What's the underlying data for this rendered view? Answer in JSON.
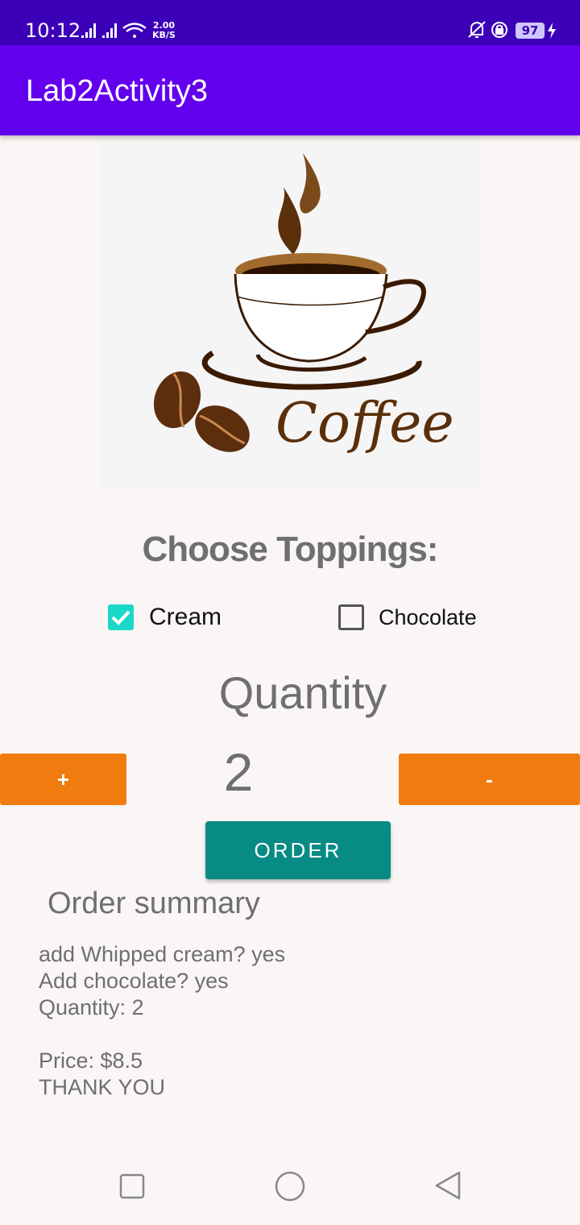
{
  "status_bar": {
    "time": "10:12",
    "net_speed_value": "2.00",
    "net_speed_unit": "KB/S",
    "battery": "97",
    "icons": [
      "signal-icon",
      "signal-icon",
      "wifi-icon",
      "mute-icon",
      "data-saver-icon",
      "battery-icon",
      "charging-icon"
    ]
  },
  "app_bar": {
    "title": "Lab2Activity3",
    "color": "#6200ee"
  },
  "hero_image": {
    "icon": "coffee-cup-logo",
    "logo_text": "Coffee"
  },
  "toppings": {
    "heading": "Choose Toppings:",
    "options": [
      {
        "label": "Cream",
        "checked": true
      },
      {
        "label": "Chocolate",
        "checked": false
      }
    ]
  },
  "quantity": {
    "title": "Quantity",
    "value": "2",
    "increment_label": "+",
    "decrement_label": "-",
    "button_color": "#f07b0e"
  },
  "order_button": {
    "label": "ORDER",
    "color": "#078b84"
  },
  "summary": {
    "title": "Order summary",
    "lines": [
      "add Whipped cream? yes",
      "Add chocolate? yes",
      "Quantity: 2",
      "",
      "Price: $8.5",
      "THANK YOU"
    ]
  },
  "nav_bar": {
    "icons": [
      "recents-square-icon",
      "home-circle-icon",
      "back-triangle-icon"
    ]
  }
}
